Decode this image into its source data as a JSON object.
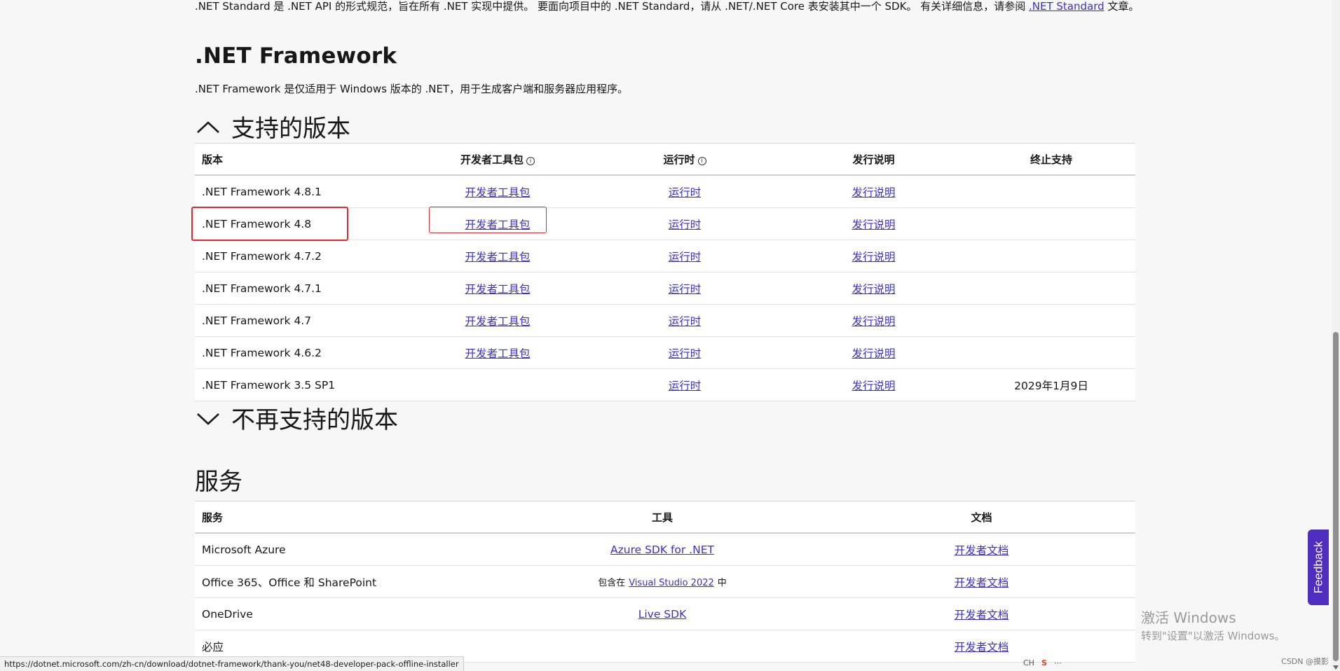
{
  "intro": {
    "text_before_link": ".NET Standard 是 .NET API 的形式规范，旨在所有 .NET 实现中提供。 要面向项目中的 .NET Standard，请从 .NET/.NET Core 表安装其中一个 SDK。 有关详细信息，请参阅",
    "link": ".NET Standard",
    "text_after_link": "文章。"
  },
  "framework": {
    "title": ".NET Framework",
    "description": ".NET Framework 是仅适用于 Windows 版本的 .NET，用于生成客户端和服务器应用程序。"
  },
  "supported": {
    "heading": "支持的版本",
    "columns": [
      "版本",
      "开发者工具包",
      "运行时",
      "发行说明",
      "终止支持"
    ],
    "rows": [
      {
        "version": ".NET Framework 4.8.1",
        "devpack": "开发者工具包",
        "runtime": "运行时",
        "notes": "发行说明",
        "eol": ""
      },
      {
        "version": ".NET Framework 4.8",
        "devpack": "开发者工具包",
        "runtime": "运行时",
        "notes": "发行说明",
        "eol": ""
      },
      {
        "version": ".NET Framework 4.7.2",
        "devpack": "开发者工具包",
        "runtime": "运行时",
        "notes": "发行说明",
        "eol": ""
      },
      {
        "version": ".NET Framework 4.7.1",
        "devpack": "开发者工具包",
        "runtime": "运行时",
        "notes": "发行说明",
        "eol": ""
      },
      {
        "version": ".NET Framework 4.7",
        "devpack": "开发者工具包",
        "runtime": "运行时",
        "notes": "发行说明",
        "eol": ""
      },
      {
        "version": ".NET Framework 4.6.2",
        "devpack": "开发者工具包",
        "runtime": "运行时",
        "notes": "发行说明",
        "eol": ""
      },
      {
        "version": ".NET Framework 3.5 SP1",
        "devpack": "",
        "runtime": "运行时",
        "notes": "发行说明",
        "eol": "2029年1月9日"
      }
    ]
  },
  "unsupported": {
    "heading": "不再支持的版本"
  },
  "services": {
    "heading": "服务",
    "columns": [
      "服务",
      "工具",
      "文档"
    ],
    "rows": [
      {
        "service": "Microsoft Azure",
        "tool_prefix": "",
        "tool_link": "Azure SDK for .NET",
        "tool_suffix": "",
        "doc": "开发者文档"
      },
      {
        "service": "Office 365、Office 和 SharePoint",
        "tool_prefix": "包含在",
        "tool_link": "Visual Studio 2022",
        "tool_suffix": "中",
        "doc": "开发者文档"
      },
      {
        "service": "OneDrive",
        "tool_prefix": "",
        "tool_link": "Live SDK",
        "tool_suffix": "",
        "doc": "开发者文档"
      },
      {
        "service": "必应",
        "tool_prefix": "",
        "tool_link": "",
        "tool_suffix": "",
        "doc": "开发者文档"
      }
    ]
  },
  "status_bar_url": "https://dotnet.microsoft.com/zh-cn/download/dotnet-framework/thank-you/net48-developer-pack-offline-installer",
  "feedback_label": "Feedback",
  "watermark": {
    "line1": "激活 Windows",
    "line2": "转到\"设置\"以激活 Windows。"
  },
  "tray": {
    "ime": "CH",
    "csdn": "CSDN @摸影"
  },
  "colors": {
    "link": "#3a2fd6",
    "highlight": "#e8262a",
    "feedback_bg": "#4f2dbf"
  }
}
